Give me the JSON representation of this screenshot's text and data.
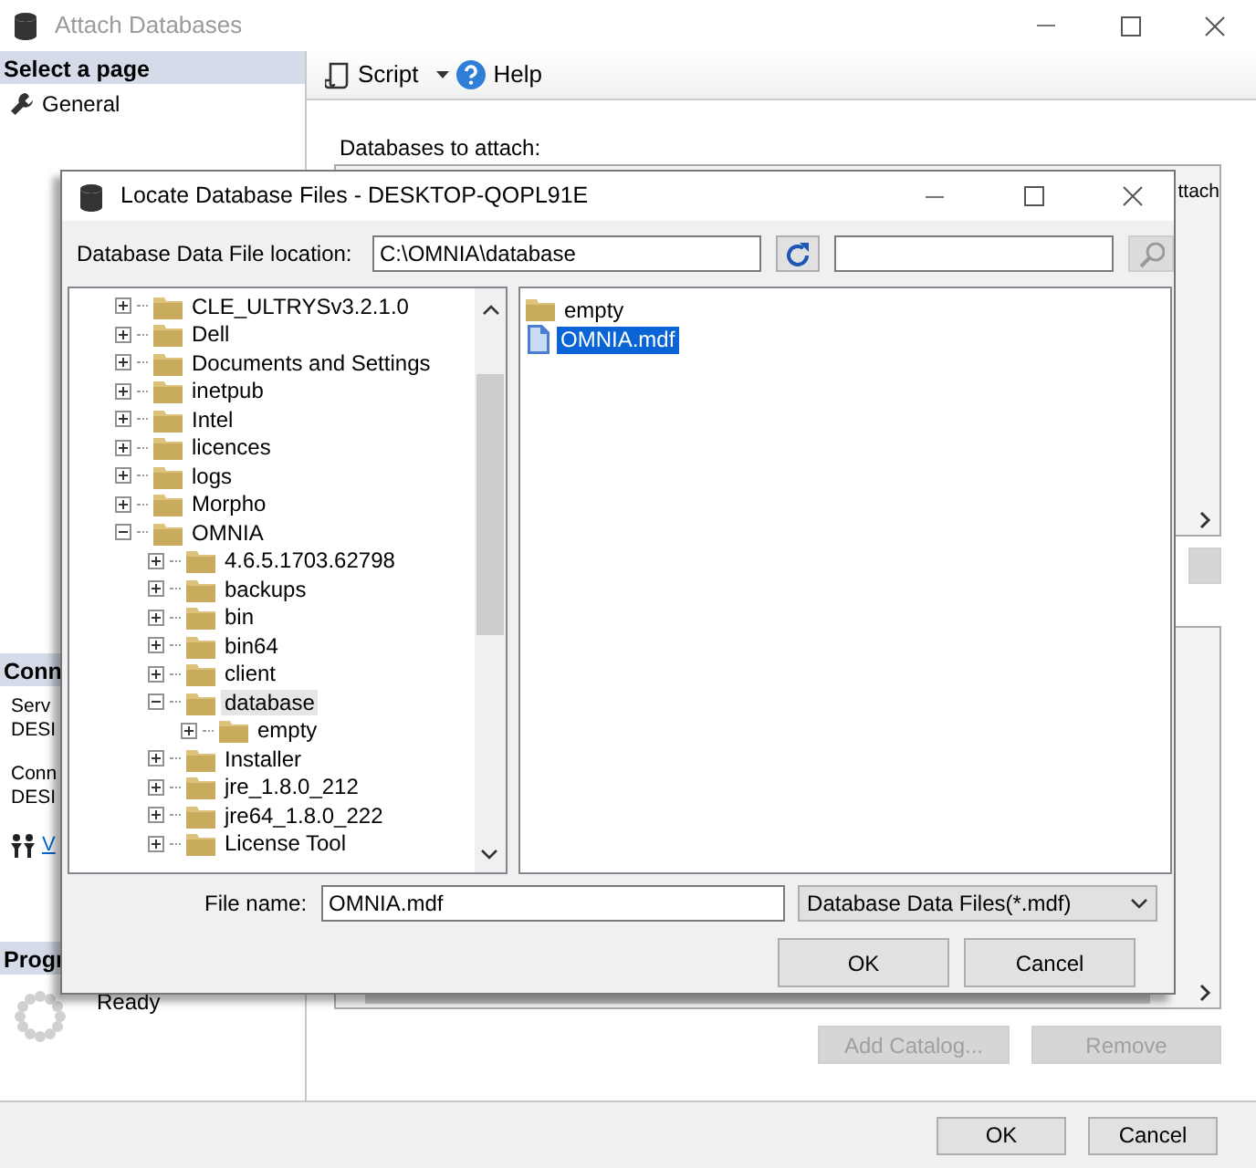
{
  "window": {
    "title": "Attach Databases"
  },
  "sidebar": {
    "header": "Select a page",
    "items": [
      {
        "label": "General"
      }
    ]
  },
  "toolbar": {
    "script": "Script",
    "help": "Help"
  },
  "databases_label": "Databases to attach:",
  "grid_header_fragment": "ttach",
  "connection": {
    "header": "Conn",
    "lines": [
      "Serv",
      "DESI",
      "Conn",
      "DESI"
    ],
    "link": "V"
  },
  "progress": {
    "header": "Progr",
    "status": "Ready"
  },
  "action_buttons": [
    {
      "label": "Add Catalog...",
      "disabled": true
    },
    {
      "label": "Remove",
      "disabled": true
    }
  ],
  "footer_buttons": [
    "OK",
    "Cancel"
  ],
  "dialog": {
    "title": "Locate Database Files - DESKTOP-QOPL91E",
    "location_label": "Database Data File location:",
    "location_value": "C:\\OMNIA\\database",
    "tree": [
      {
        "label": "CLE_ULTRYSv3.2.1.0",
        "expanded": false,
        "selected": false
      },
      {
        "label": "Dell",
        "expanded": false,
        "selected": false
      },
      {
        "label": "Documents and Settings",
        "expanded": false,
        "selected": false
      },
      {
        "label": "inetpub",
        "expanded": false,
        "selected": false
      },
      {
        "label": "Intel",
        "expanded": false,
        "selected": false
      },
      {
        "label": "licences",
        "expanded": false,
        "selected": false
      },
      {
        "label": "logs",
        "expanded": false,
        "selected": false
      },
      {
        "label": "Morpho",
        "expanded": false,
        "selected": false
      },
      {
        "label": "OMNIA",
        "expanded": true,
        "selected": false,
        "children": [
          {
            "label": "4.6.5.1703.62798",
            "expanded": false,
            "selected": false
          },
          {
            "label": "backups",
            "expanded": false,
            "selected": false
          },
          {
            "label": "bin",
            "expanded": false,
            "selected": false
          },
          {
            "label": "bin64",
            "expanded": false,
            "selected": false
          },
          {
            "label": "client",
            "expanded": false,
            "selected": false
          },
          {
            "label": "database",
            "expanded": true,
            "selected": true,
            "children": [
              {
                "label": "empty",
                "expanded": false,
                "selected": false
              }
            ]
          },
          {
            "label": "Installer",
            "expanded": false,
            "selected": false
          },
          {
            "label": "jre_1.8.0_212",
            "expanded": false,
            "selected": false
          },
          {
            "label": "jre64_1.8.0_222",
            "expanded": false,
            "selected": false
          },
          {
            "label": "License Tool",
            "expanded": false,
            "selected": false
          }
        ]
      }
    ],
    "files": [
      {
        "name": "empty",
        "kind": "folder",
        "selected": false
      },
      {
        "name": "OMNIA.mdf",
        "kind": "file",
        "selected": true
      }
    ],
    "file_name_label": "File name:",
    "file_name_value": "OMNIA.mdf",
    "file_type": "Database Data Files(*.mdf)",
    "buttons": [
      "OK",
      "Cancel"
    ]
  }
}
